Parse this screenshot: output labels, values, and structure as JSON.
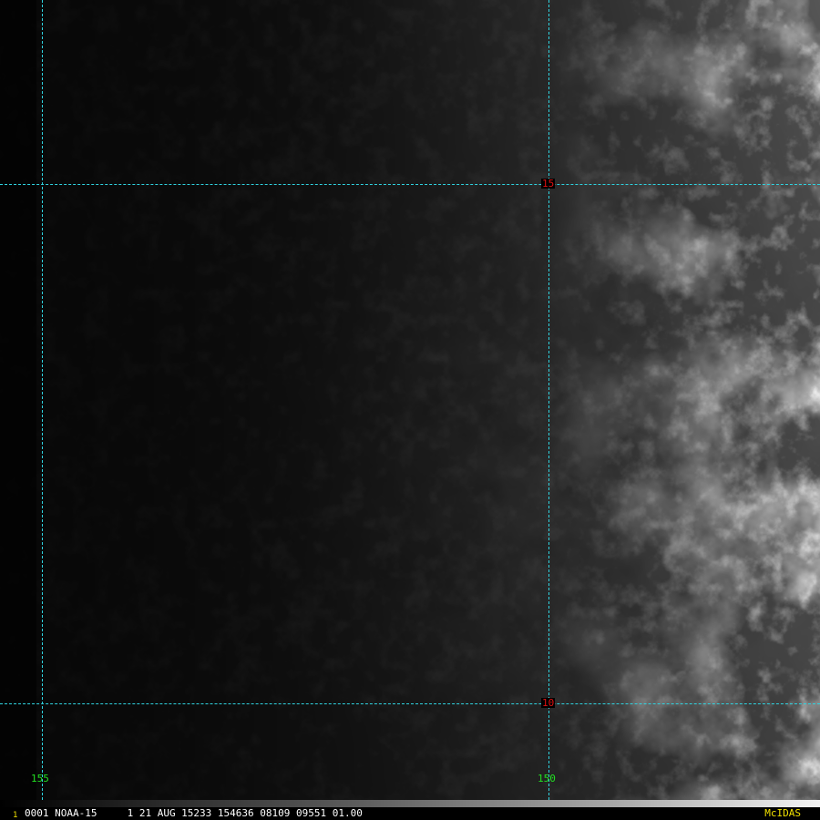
{
  "colors": {
    "grid": "#2fd3e0",
    "lat_label": "#e01010",
    "lon_label": "#22e022",
    "footer_text": "#ffffff",
    "frame_number": "#f0e000",
    "brand": "#f0e000"
  },
  "grid": {
    "latitudes": [
      {
        "value": 15,
        "label": "15"
      },
      {
        "value": 10,
        "label": "10"
      }
    ],
    "longitudes": [
      {
        "value": 155,
        "label": "155"
      },
      {
        "value": 150,
        "label": "150"
      }
    ]
  },
  "footer": {
    "frame_number": "1",
    "text": "0001 NOAA-15     1 21 AUG 15233 154636 08109 09551 01.00",
    "brand": "McIDAS"
  }
}
